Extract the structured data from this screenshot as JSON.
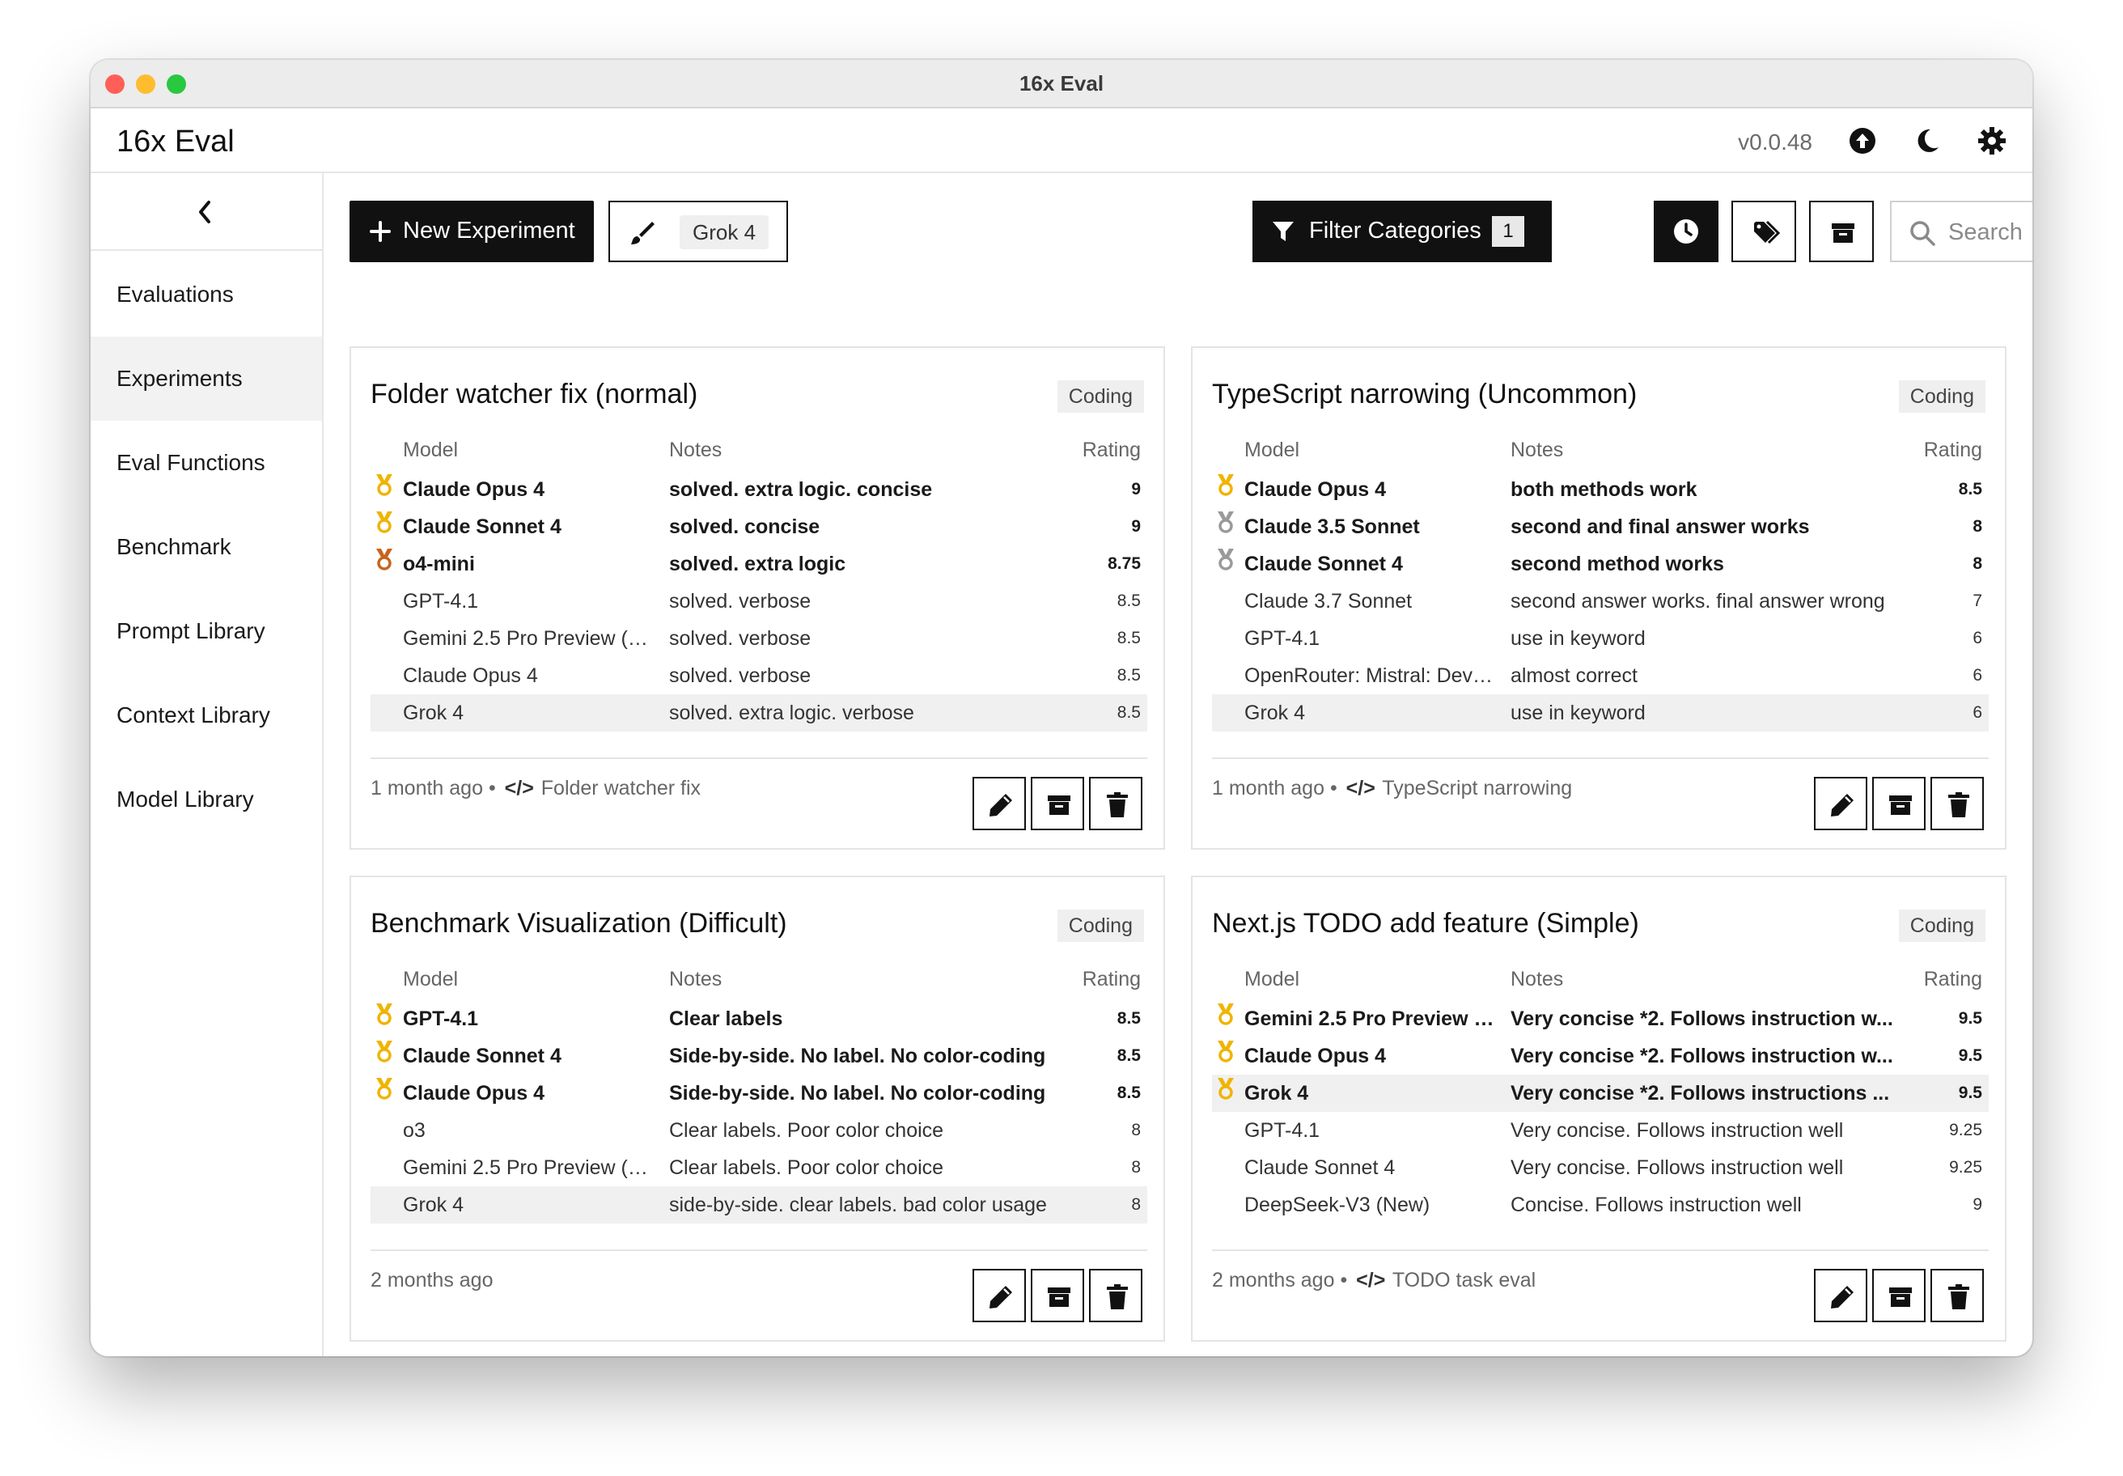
{
  "window": {
    "title": "16x Eval"
  },
  "header": {
    "app_title": "16x Eval",
    "version": "v0.0.48"
  },
  "sidebar": {
    "items": [
      {
        "label": "Evaluations",
        "active": false
      },
      {
        "label": "Experiments",
        "active": true
      },
      {
        "label": "Eval Functions",
        "active": false
      },
      {
        "label": "Benchmark",
        "active": false
      },
      {
        "label": "Prompt Library",
        "active": false
      },
      {
        "label": "Context Library",
        "active": false
      },
      {
        "label": "Model Library",
        "active": false
      }
    ]
  },
  "toolbar": {
    "new_experiment_label": "New Experiment",
    "highlight_model": "Grok 4",
    "filter_label": "Filter Categories",
    "filter_count": "1",
    "search_placeholder": "Search"
  },
  "table_headers": {
    "model": "Model",
    "notes": "Notes",
    "rating": "Rating"
  },
  "colors": {
    "gold": "#f0b400",
    "silver": "#9a9a9a",
    "bronze": "#c8641e"
  },
  "cards": [
    {
      "title": "Folder watcher fix (normal)",
      "category": "Coding",
      "time": "1 month ago",
      "separator": " • ",
      "context": "Folder watcher fix",
      "rows": [
        {
          "model": "Claude Opus 4",
          "notes": "solved. extra logic. concise",
          "rating": "9",
          "medal": "gold"
        },
        {
          "model": "Claude Sonnet 4",
          "notes": "solved. concise",
          "rating": "9",
          "medal": "gold"
        },
        {
          "model": "o4-mini",
          "notes": "solved. extra logic",
          "rating": "8.75",
          "medal": "bronze"
        },
        {
          "model": "GPT-4.1",
          "notes": "solved. verbose",
          "rating": "8.5"
        },
        {
          "model": "Gemini 2.5 Pro Preview (0...",
          "notes": "solved. verbose",
          "rating": "8.5"
        },
        {
          "model": "Claude Opus 4",
          "notes": "solved. verbose",
          "rating": "8.5"
        },
        {
          "model": "Grok 4",
          "notes": "solved. extra logic. verbose",
          "rating": "8.5",
          "highlight": true
        }
      ]
    },
    {
      "title": "TypeScript narrowing (Uncommon)",
      "category": "Coding",
      "time": "1 month ago",
      "separator": " • ",
      "context": "TypeScript narrowing",
      "rows": [
        {
          "model": "Claude Opus 4",
          "notes": "both methods work",
          "rating": "8.5",
          "medal": "gold"
        },
        {
          "model": "Claude 3.5 Sonnet",
          "notes": "second and final answer works",
          "rating": "8",
          "medal": "silver"
        },
        {
          "model": "Claude Sonnet 4",
          "notes": "second method works",
          "rating": "8",
          "medal": "silver"
        },
        {
          "model": "Claude 3.7 Sonnet",
          "notes": "second answer works. final answer wrong",
          "rating": "7"
        },
        {
          "model": "GPT-4.1",
          "notes": "use in keyword",
          "rating": "6"
        },
        {
          "model": "OpenRouter: Mistral: Devs...",
          "notes": "almost correct",
          "rating": "6"
        },
        {
          "model": "Grok 4",
          "notes": "use in keyword",
          "rating": "6",
          "highlight": true
        }
      ]
    },
    {
      "title": "Benchmark Visualization (Difficult)",
      "category": "Coding",
      "time": "2 months ago",
      "separator": "",
      "context": "",
      "rows": [
        {
          "model": "GPT-4.1",
          "notes": "Clear labels",
          "rating": "8.5",
          "medal": "gold"
        },
        {
          "model": "Claude Sonnet 4",
          "notes": "Side-by-side. No label. No color-coding",
          "rating": "8.5",
          "medal": "gold"
        },
        {
          "model": "Claude Opus 4",
          "notes": "Side-by-side. No label. No color-coding",
          "rating": "8.5",
          "medal": "gold"
        },
        {
          "model": "o3",
          "notes": "Clear labels. Poor color choice",
          "rating": "8"
        },
        {
          "model": "Gemini 2.5 Pro Preview (0...",
          "notes": "Clear labels. Poor color choice",
          "rating": "8"
        },
        {
          "model": "Grok 4",
          "notes": "side-by-side. clear labels. bad color usage",
          "rating": "8",
          "highlight": true
        }
      ]
    },
    {
      "title": "Next.js TODO add feature (Simple)",
      "category": "Coding",
      "time": "2 months ago",
      "separator": " • ",
      "context": "TODO task eval",
      "rows": [
        {
          "model": "Gemini 2.5 Pro Preview (...",
          "notes": "Very concise *2. Follows instruction w...",
          "rating": "9.5",
          "medal": "gold"
        },
        {
          "model": "Claude Opus 4",
          "notes": "Very concise *2. Follows instruction w...",
          "rating": "9.5",
          "medal": "gold"
        },
        {
          "model": "Grok 4",
          "notes": "Very concise *2. Follows instructions ...",
          "rating": "9.5",
          "medal": "gold",
          "highlight": true
        },
        {
          "model": "GPT-4.1",
          "notes": "Very concise. Follows instruction well",
          "rating": "9.25"
        },
        {
          "model": "Claude Sonnet 4",
          "notes": "Very concise. Follows instruction well",
          "rating": "9.25"
        },
        {
          "model": "DeepSeek-V3 (New)",
          "notes": "Concise. Follows instruction well",
          "rating": "9"
        }
      ]
    }
  ]
}
